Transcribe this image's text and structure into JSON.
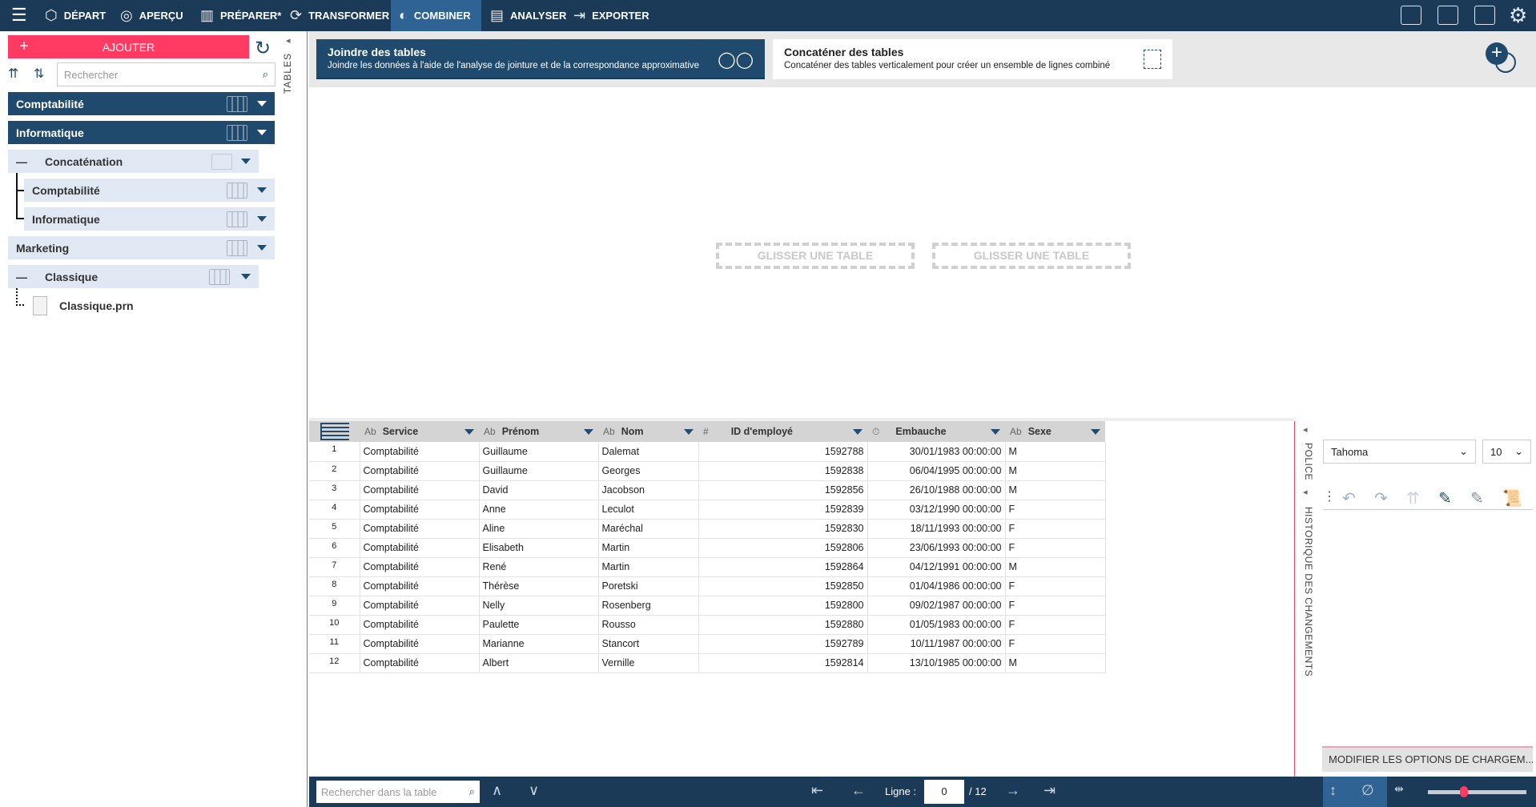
{
  "topbar": {
    "menu_icon": "hamburger-icon",
    "items": [
      {
        "label": "DÉPART",
        "icon": "cube-icon"
      },
      {
        "label": "APERÇU",
        "icon": "eye-icon"
      },
      {
        "label": "PRÉPARER*",
        "icon": "columns-icon"
      },
      {
        "label": "TRANSFORMER",
        "icon": "cycle-icon"
      },
      {
        "label": "COMBINER",
        "icon": "venn-icon",
        "active": true
      },
      {
        "label": "ANALYSER",
        "icon": "clipboard-icon"
      },
      {
        "label": "EXPORTER",
        "icon": "export-icon"
      }
    ]
  },
  "left": {
    "add_label": "AJOUTER",
    "search_placeholder": "Rechercher",
    "tables_label": "TABLES",
    "tree": [
      {
        "label": "Comptabilité"
      },
      {
        "label": "Informatique"
      },
      {
        "label": "Concaténation"
      },
      {
        "label": "Comptabilité"
      },
      {
        "label": "Informatique"
      },
      {
        "label": "Marketing"
      },
      {
        "label": "Classique"
      },
      {
        "label": "Classique.prn"
      }
    ]
  },
  "combine": {
    "join_title": "Joindre des tables",
    "join_desc": "Joindre les données à l'aide de l'analyse de jointure et de la correspondance approximative",
    "concat_title": "Concaténer des tables",
    "concat_desc": "Concaténer des tables verticalement pour créer un ensemble de lignes combiné",
    "drop1": "GLISSER UNE TABLE",
    "drop2": "GLISSER UNE TABLE"
  },
  "table": {
    "columns": [
      {
        "type": "Ab",
        "name": "Service"
      },
      {
        "type": "Ab",
        "name": "Prénom"
      },
      {
        "type": "Ab",
        "name": "Nom"
      },
      {
        "type": "#",
        "name": "ID d'employé"
      },
      {
        "type": "⏱",
        "name": "Embauche"
      },
      {
        "type": "Ab",
        "name": "Sexe"
      }
    ],
    "rows": [
      [
        "1",
        "Comptabilité",
        "Guillaume",
        "Dalemat",
        "1592788",
        "30/01/1983 00:00:00",
        "M"
      ],
      [
        "2",
        "Comptabilité",
        "Guillaume",
        "Georges",
        "1592838",
        "06/04/1995 00:00:00",
        "M"
      ],
      [
        "3",
        "Comptabilité",
        "David",
        "Jacobson",
        "1592856",
        "26/10/1988 00:00:00",
        "M"
      ],
      [
        "4",
        "Comptabilité",
        "Anne",
        "Leculot",
        "1592839",
        "03/12/1990 00:00:00",
        "F"
      ],
      [
        "5",
        "Comptabilité",
        "Aline",
        "Maréchal",
        "1592830",
        "18/11/1993 00:00:00",
        "F"
      ],
      [
        "6",
        "Comptabilité",
        "Elisabeth",
        "Martin",
        "1592806",
        "23/06/1993 00:00:00",
        "F"
      ],
      [
        "7",
        "Comptabilité",
        "René",
        "Martin",
        "1592864",
        "04/12/1991 00:00:00",
        "M"
      ],
      [
        "8",
        "Comptabilité",
        "Thérèse",
        "Poretski",
        "1592850",
        "01/04/1986 00:00:00",
        "F"
      ],
      [
        "9",
        "Comptabilité",
        "Nelly",
        "Rosenberg",
        "1592800",
        "09/02/1987 00:00:00",
        "F"
      ],
      [
        "10",
        "Comptabilité",
        "Paulette",
        "Rousso",
        "1592880",
        "01/05/1983 00:00:00",
        "F"
      ],
      [
        "11",
        "Comptabilité",
        "Marianne",
        "Stancort",
        "1592789",
        "10/11/1987 00:00:00",
        "F"
      ],
      [
        "12",
        "Comptabilité",
        "Albert",
        "Vernille",
        "1592814",
        "13/10/1985 00:00:00",
        "M"
      ]
    ]
  },
  "right": {
    "police_label": "POLICE",
    "history_label": "HISTORIQUE DES CHANGEMENTS",
    "font": "Tahoma",
    "size": "10",
    "modify_label": "MODIFIER LES OPTIONS DE CHARGEM..."
  },
  "bottom": {
    "search_placeholder": "Rechercher dans la table",
    "ligne_label": "Ligne :",
    "ligne_value": "0",
    "total": "/ 12"
  },
  "colors": {
    "nav": "#1b3a57",
    "accent": "#ff3b63",
    "dark_item": "#1f4a6e",
    "light_item": "#e0e8f3"
  }
}
